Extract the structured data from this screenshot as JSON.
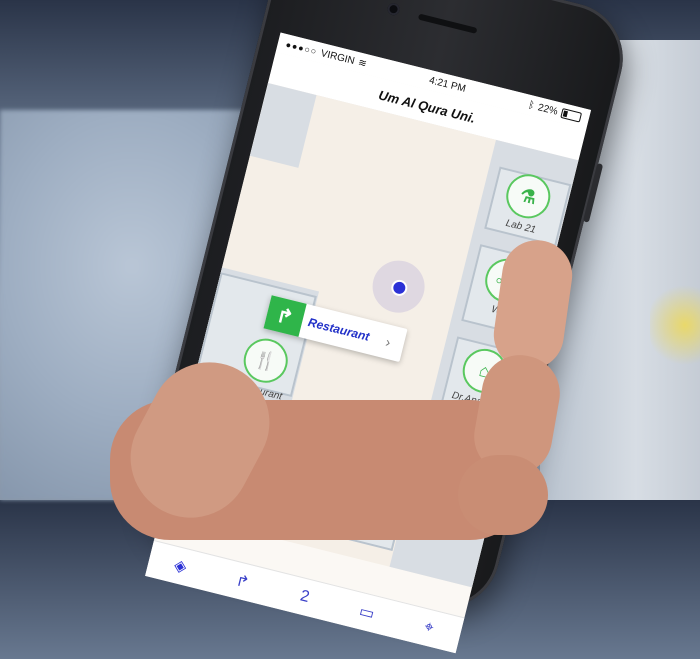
{
  "status_bar": {
    "carrier": "VIRGIN",
    "time": "4:21 PM",
    "battery": "22%"
  },
  "navigation": {
    "title": "Um Al Qura Uni."
  },
  "map": {
    "callout": {
      "label": "Restaurant"
    },
    "points_of_interest": [
      {
        "label": "Lab 21",
        "icon": "lab-flask-icon"
      },
      {
        "label": "WC",
        "icon": "restroom-icon"
      },
      {
        "label": "Dr.Anas Ott",
        "icon": "classroom-icon"
      },
      {
        "label": "Restaurant",
        "icon": "fork-knife-icon"
      }
    ]
  },
  "tabbar": {
    "tabs": [
      {
        "name": "compass",
        "icon": "navigation-icon"
      },
      {
        "name": "directions",
        "icon": "route-icon"
      },
      {
        "name": "floor",
        "icon": "floor-2-icon"
      },
      {
        "name": "map",
        "icon": "map-icon"
      },
      {
        "name": "pin",
        "icon": "location-pin-icon"
      }
    ],
    "floor_label": "2"
  },
  "colors": {
    "accent": "#2b31d6",
    "poi_green": "#2fb54a",
    "map_bg": "#f5efe7"
  }
}
